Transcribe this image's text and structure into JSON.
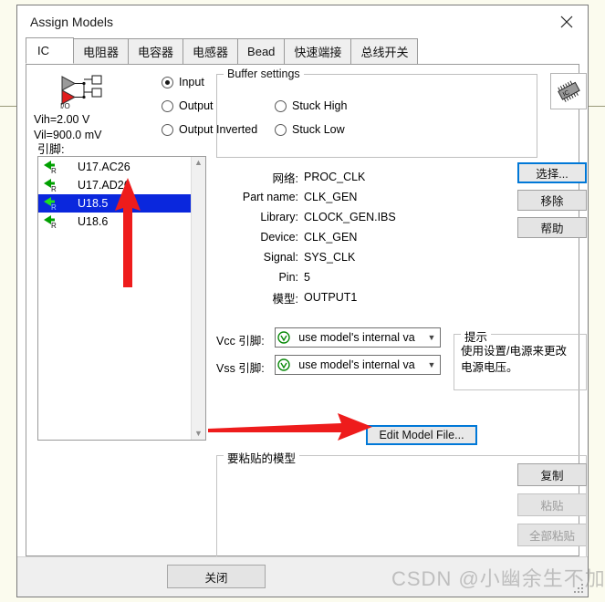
{
  "window": {
    "title": "Assign Models",
    "close_icon": "close-icon"
  },
  "tabs": [
    {
      "label": "IC",
      "selected": true
    },
    {
      "label": "电阻器",
      "selected": false
    },
    {
      "label": "电容器",
      "selected": false
    },
    {
      "label": "电感器",
      "selected": false
    },
    {
      "label": "Bead",
      "selected": false
    },
    {
      "label": "快速端接",
      "selected": false
    },
    {
      "label": "总线开关",
      "selected": false
    }
  ],
  "pins": {
    "label": "引脚:",
    "items": [
      {
        "name": "U17.AC26",
        "icon": "pin-input-r-icon",
        "selected": false
      },
      {
        "name": "U17.AD26",
        "icon": "pin-input-r-icon",
        "selected": false
      },
      {
        "name": "U18.5",
        "icon": "pin-input-r-icon",
        "selected": true
      },
      {
        "name": "U18.6",
        "icon": "pin-input-r-icon",
        "selected": false
      }
    ],
    "scroll_up_icon": "chevron-up-icon",
    "scroll_down_icon": "chevron-down-icon"
  },
  "buffer_settings": {
    "legend": "Buffer settings",
    "icon": "io-buffer-icon",
    "icon_caption": "I/O",
    "vih": "Vih=2.00 V",
    "vil": "Vil=900.0 mV",
    "options": [
      {
        "id": "input",
        "label": "Input",
        "checked": true
      },
      {
        "id": "output",
        "label": "Output",
        "checked": false
      },
      {
        "id": "output_inverted",
        "label": "Output Inverted",
        "checked": false
      },
      {
        "id": "stuck_high",
        "label": "Stuck High",
        "checked": false
      },
      {
        "id": "stuck_low",
        "label": "Stuck Low",
        "checked": false
      }
    ]
  },
  "ic_thumbnail": {
    "icon": "ic-chip-icon",
    "chip_text": "IC"
  },
  "info_fields": [
    {
      "label": "网络:",
      "value": "PROC_CLK"
    },
    {
      "label": "Part name:",
      "value": "CLK_GEN"
    },
    {
      "label": "Library:",
      "value": "CLOCK_GEN.IBS"
    },
    {
      "label": "Device:",
      "value": "CLK_GEN"
    },
    {
      "label": "Signal:",
      "value": "SYS_CLK"
    },
    {
      "label": "Pin:",
      "value": "5"
    },
    {
      "label": "模型:",
      "value": "OUTPUT1"
    }
  ],
  "action_buttons": {
    "select": "选择...",
    "remove": "移除",
    "help": "帮助"
  },
  "power_pins": {
    "vcc_label": "Vcc 引脚:",
    "vss_label": "Vss 引脚:",
    "vcc_value": "use model's internal va",
    "vss_value": "use model's internal va",
    "combo_icon": "power-model-icon",
    "arrow_icon": "chevron-down-icon"
  },
  "tip": {
    "legend": "提示",
    "line1": "使用设置/电源来更改",
    "line2": "电源电压。"
  },
  "edit_model_button": "Edit Model File...",
  "paste_group": {
    "legend": "要粘贴的模型",
    "copy": "复制",
    "paste": "粘贴",
    "paste_all": "全部粘贴"
  },
  "bottom": {
    "close": "关闭"
  },
  "watermark": "CSDN @小幽余生不加糖",
  "colors": {
    "selection_blue": "#0a27dd",
    "focus_blue": "#0078d7",
    "annotation_red": "#ee1c1c",
    "backdrop": "#fbfbee",
    "button_face": "#e4e4e4"
  }
}
